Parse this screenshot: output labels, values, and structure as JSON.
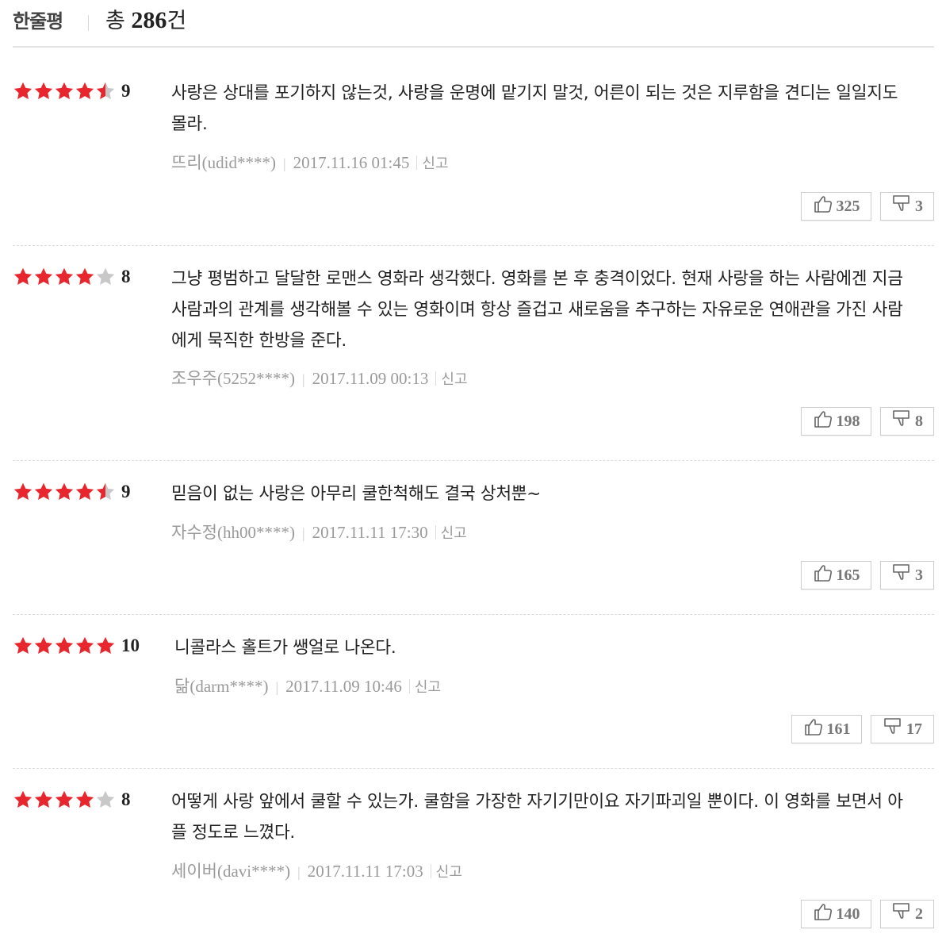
{
  "header": {
    "title": "한줄평",
    "count_prefix": "총",
    "count": "286",
    "count_suffix": "건"
  },
  "colors": {
    "star_on": "#e8262e",
    "star_off": "#c8c8c8"
  },
  "reviews": [
    {
      "rating": 4.5,
      "score": "9",
      "text": "사랑은 상대를 포기하지 않는것, 사랑을 운명에 맡기지 말것, 어른이 되는 것은 지루함을 견디는 일일지도 몰라.",
      "author_name": "뜨리",
      "author_id": "(udid****)",
      "date": "2017.11.16 01:45",
      "report": "신고",
      "likes": "325",
      "dislikes": "3"
    },
    {
      "rating": 4,
      "score": "8",
      "text": "그냥 평범하고 달달한 로맨스 영화라 생각했다. 영화를 본 후 충격이었다. 현재 사랑을 하는 사람에겐 지금사람과의 관계를 생각해볼 수 있는 영화이며 항상 즐겁고 새로움을 추구하는 자유로운 연애관을 가진 사람에게 묵직한 한방을 준다.",
      "author_name": "조우주",
      "author_id": "(5252****)",
      "date": "2017.11.09 00:13",
      "report": "신고",
      "likes": "198",
      "dislikes": "8"
    },
    {
      "rating": 4.5,
      "score": "9",
      "text": "믿음이 없는 사랑은 아무리 쿨한척해도 결국 상처뿐~",
      "author_name": "자수정",
      "author_id": "(hh00****)",
      "date": "2017.11.11 17:30",
      "report": "신고",
      "likes": "165",
      "dislikes": "3"
    },
    {
      "rating": 5,
      "score": "10",
      "text": "니콜라스 홀트가 쌩얼로 나온다.",
      "author_name": "닮",
      "author_id": "(darm****)",
      "date": "2017.11.09 10:46",
      "report": "신고",
      "likes": "161",
      "dislikes": "17"
    },
    {
      "rating": 4,
      "score": "8",
      "text": "어떻게 사랑 앞에서 쿨할 수 있는가. 쿨함을 가장한 자기기만이요 자기파괴일 뿐이다. 이 영화를 보면서 아플 정도로 느꼈다.",
      "author_name": "세이버",
      "author_id": "(davi****)",
      "date": "2017.11.11 17:03",
      "report": "신고",
      "likes": "140",
      "dislikes": "2"
    }
  ]
}
